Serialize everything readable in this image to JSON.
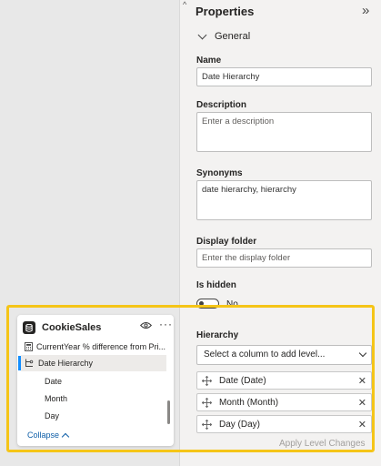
{
  "canvas": {},
  "properties": {
    "title": "Properties",
    "section": "General",
    "name_label": "Name",
    "name_value": "Date Hierarchy",
    "description_label": "Description",
    "description_placeholder": "Enter a description",
    "synonyms_label": "Synonyms",
    "synonyms_value": "date hierarchy, hierarchy",
    "display_folder_label": "Display folder",
    "display_folder_placeholder": "Enter the display folder",
    "is_hidden_label": "Is hidden",
    "is_hidden_value": "No",
    "hierarchy_label": "Hierarchy",
    "hierarchy_select": "Select a column to add level...",
    "levels": [
      {
        "label": "Date (Date)"
      },
      {
        "label": "Month (Month)"
      },
      {
        "label": "Day (Day)"
      }
    ],
    "apply_button": "Apply Level Changes"
  },
  "fieldlist": {
    "table_name": "CookieSales",
    "items": [
      {
        "label": "CurrentYear % difference from Pri..."
      },
      {
        "label": "Date Hierarchy"
      },
      {
        "label": "Date"
      },
      {
        "label": "Month"
      },
      {
        "label": "Day"
      }
    ],
    "collapse_label": "Collapse"
  },
  "colors": {
    "highlight": "#f5c518",
    "selection_accent": "#118dff",
    "link": "#0f5fa8"
  }
}
